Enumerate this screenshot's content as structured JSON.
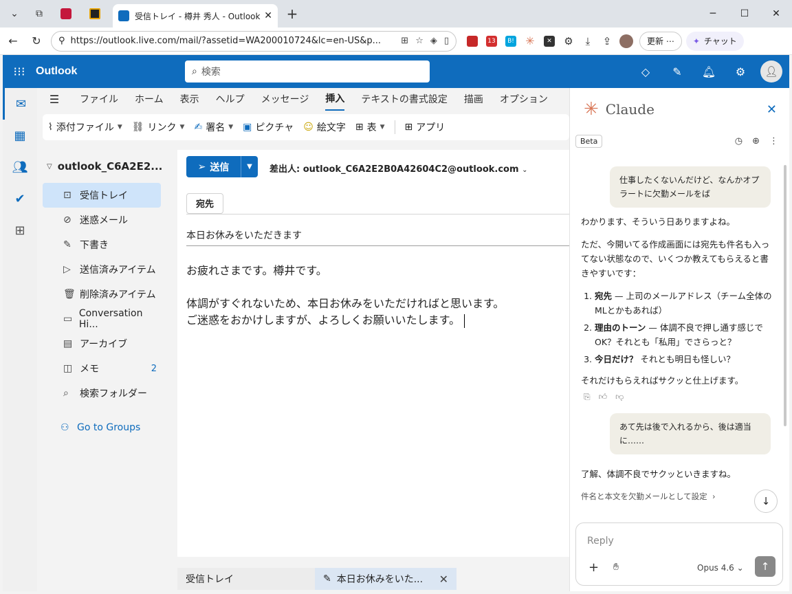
{
  "browser": {
    "tab_title": "受信トレイ - 樽井 秀人 - Outlook",
    "url": "https://outlook.live.com/mail/?assetid=WA200010724&lc=en-US&p...",
    "update_label": "更新",
    "chat_label": "チャット",
    "ext_badge": "13",
    "ext_b": "B!"
  },
  "outlook": {
    "brand": "Outlook",
    "search_placeholder": "検索",
    "ribbon_tabs": [
      "ファイル",
      "ホーム",
      "表示",
      "ヘルプ",
      "メッセージ",
      "挿入",
      "テキストの書式設定",
      "描画",
      "オプション"
    ],
    "active_tab": "挿入",
    "commands": [
      "添付ファイル",
      "リンク",
      "署名",
      "ピクチャ",
      "絵文字",
      "表",
      "アプリ"
    ],
    "account": "outlook_C6A2E2...",
    "folders": [
      {
        "label": "受信トレイ"
      },
      {
        "label": "迷惑メール"
      },
      {
        "label": "下書き"
      },
      {
        "label": "送信済みアイテム"
      },
      {
        "label": "削除済みアイテム"
      },
      {
        "label": "Conversation Hi..."
      },
      {
        "label": "アーカイブ"
      },
      {
        "label": "メモ",
        "count": "2"
      },
      {
        "label": "検索フォルダー"
      }
    ],
    "go_to_groups": "Go to Groups",
    "compose": {
      "send_label": "送信",
      "from": "差出人: outlook_C6A2E2B0A42604C2@outlook.com",
      "to_label": "宛先",
      "subject": "本日お休みをいただきます",
      "body_line1": "お疲れさまです。樽井です。",
      "body_line2": "体調がすぐれないため、本日お休みをいただければと思います。",
      "body_line3": "ご迷惑をおかけしますが、よろしくお願いいたします。"
    },
    "bottom_tabs": {
      "inbox": "受信トレイ",
      "draft": "本日お休みをいた..."
    }
  },
  "claude": {
    "title": "Claude",
    "beta": "Beta",
    "user_msg_1": "仕事したくないんだけど、なんかオプラートに欠勤メールをば",
    "assistant_1": {
      "p1": "わかります、そういう日ありますよね。",
      "p2": "ただ、今開いてる作成画面には宛先も件名も入ってない状態なので、いくつか教えてもらえると書きやすいです：",
      "items": [
        {
          "bold": "宛先",
          "text": " — 上司のメールアドレス（チーム全体のMLとかもあれば）"
        },
        {
          "bold": "理由のトーン",
          "text": " — 体調不良で押し通す感じでOK？それとも「私用」でさらっと？"
        },
        {
          "bold": "今日だけ？",
          "text": " それとも明日も怪しい？"
        }
      ],
      "p3": "それだけもらえればサクッと仕上げます。"
    },
    "user_msg_2": "あて先は後で入れるから、後は適当に……",
    "assistant_2": "了解、体調不良でサクッといきますね。",
    "action_link": "件名と本文を欠勤メールとして設定",
    "reply_placeholder": "Reply",
    "model": "Opus 4.6"
  }
}
